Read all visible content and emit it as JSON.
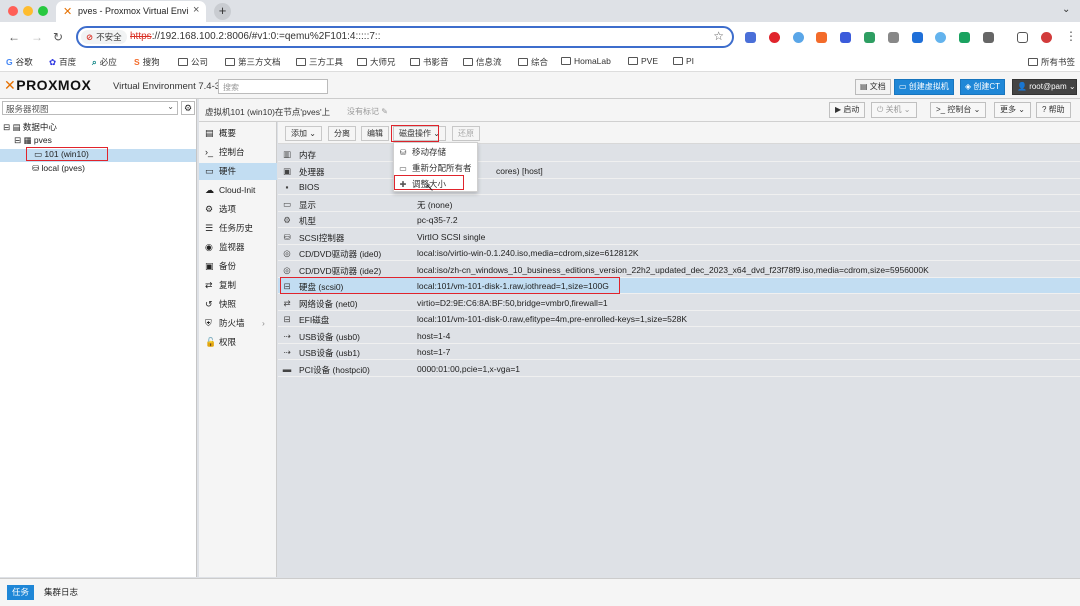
{
  "browser": {
    "tab_title": "pves - Proxmox Virtual Environment",
    "insecure_label": "不安全",
    "url_proto": "https",
    "url_rest": "://192.168.100.2:8006/#v1:0:=qemu%2F101:4:::::7::",
    "bookmarks": [
      "谷歌",
      "百度",
      "必应",
      "搜狗",
      "公司",
      "第三方文档",
      "三方工具",
      "大师兄",
      "书影音",
      "信息流",
      "综合",
      "HomaLab",
      "PVE",
      "PI"
    ],
    "all_bookmarks": "所有书签"
  },
  "header": {
    "brand": "PROXMOX",
    "version": "Virtual Environment 7.4-3",
    "search_placeholder": "搜索",
    "docs": "文档",
    "create_vm": "创建虚拟机",
    "create_ct": "创建CT",
    "user": "root@pam"
  },
  "tree": {
    "view": "服务器视图",
    "datacenter": "数据中心",
    "node": "pves",
    "vm": "101 (win10)",
    "storage": "local (pves)"
  },
  "crumb": {
    "title": "虚拟机101 (win10)在节点'pves'上",
    "tags": "没有标记"
  },
  "actions": {
    "start": "启动",
    "shutdown": "关机",
    "console": "控制台",
    "more": "更多",
    "help": "帮助"
  },
  "nav": [
    "概要",
    "控制台",
    "硬件",
    "Cloud-Init",
    "选项",
    "任务历史",
    "监视器",
    "备份",
    "复制",
    "快照",
    "防火墙",
    "权限"
  ],
  "hw_toolbar": {
    "add": "添加",
    "detach": "分离",
    "edit": "编辑",
    "disk_action": "磁盘操作",
    "revert": "还原"
  },
  "disk_menu": [
    "移动存储",
    "重新分配所有者",
    "调整大小"
  ],
  "hardware": [
    {
      "key": "内存",
      "value": ""
    },
    {
      "key": "处理器",
      "value": "cores) [host]"
    },
    {
      "key": "BIOS",
      "value": ""
    },
    {
      "key": "显示",
      "value": "无 (none)"
    },
    {
      "key": "机型",
      "value": "pc-q35-7.2"
    },
    {
      "key": "SCSI控制器",
      "value": "VirtIO SCSI single"
    },
    {
      "key": "CD/DVD驱动器 (ide0)",
      "value": "local:iso/virtio-win-0.1.240.iso,media=cdrom,size=612812K"
    },
    {
      "key": "CD/DVD驱动器 (ide2)",
      "value": "local:iso/zh-cn_windows_10_business_editions_version_22h2_updated_dec_2023_x64_dvd_f23f78f9.iso,media=cdrom,size=5956000K"
    },
    {
      "key": "硬盘 (scsi0)",
      "value": "local:101/vm-101-disk-1.raw,iothread=1,size=100G"
    },
    {
      "key": "网络设备 (net0)",
      "value": "virtio=D2:9E:C6:8A:BF:50,bridge=vmbr0,firewall=1"
    },
    {
      "key": "EFI磁盘",
      "value": "local:101/vm-101-disk-0.raw,efitype=4m,pre-enrolled-keys=1,size=528K"
    },
    {
      "key": "USB设备 (usb0)",
      "value": "host=1-4"
    },
    {
      "key": "USB设备 (usb1)",
      "value": "host=1-7"
    },
    {
      "key": "PCI设备 (hostpci0)",
      "value": "0000:01:00,pcie=1,x-vga=1"
    }
  ],
  "bottom": {
    "tasks": "任务",
    "cluster_log": "集群日志"
  }
}
